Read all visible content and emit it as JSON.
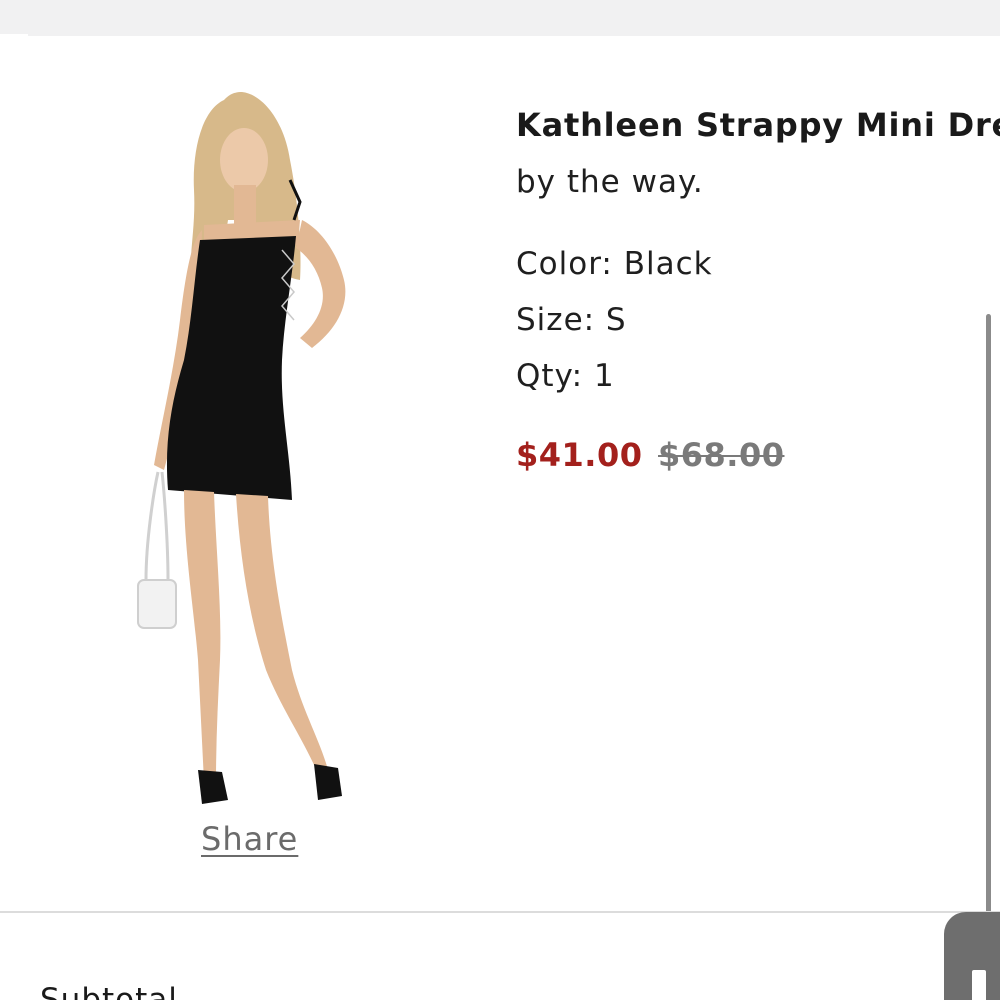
{
  "product": {
    "title": "Kathleen Strappy Mini Dress",
    "brand": "by the way.",
    "color": "Color: Black",
    "size": "Size: S",
    "qty": "Qty: 1",
    "sale_price": "$41.00",
    "original_price": "$68.00",
    "image_alt": "Model wearing black strappy mini dress"
  },
  "share": {
    "label": "Share"
  },
  "summary": {
    "subtotal_label": "Subtotal"
  },
  "colors": {
    "sale_price": "#a3201c",
    "original_price": "#7a7a7a",
    "link": "#6b6b6b"
  }
}
